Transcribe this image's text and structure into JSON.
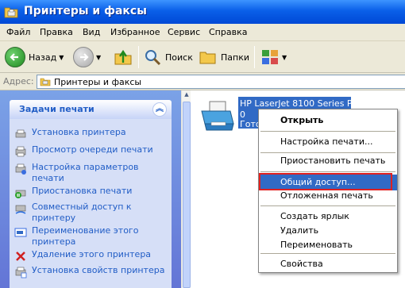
{
  "window": {
    "title": "Принтеры и факсы"
  },
  "menubar": [
    "Файл",
    "Правка",
    "Вид",
    "Избранное",
    "Сервис",
    "Справка"
  ],
  "toolbar": {
    "back_label": "Назад",
    "search_label": "Поиск",
    "folders_label": "Папки"
  },
  "address": {
    "label": "Адрес:",
    "value": "Принтеры и факсы"
  },
  "tasks_panel": {
    "title": "Задачи печати",
    "items": [
      "Установка принтера",
      "Просмотр очереди печати",
      "Настройка параметров печати",
      "Приостановка печати",
      "Совместный доступ к принтеру",
      "Переименование этого принтера",
      "Удаление этого принтера",
      "Установка свойств принтера"
    ]
  },
  "printer": {
    "name": "HP LaserJet 8100 Series PCL",
    "count": "0",
    "status": "Готов"
  },
  "context_menu": {
    "items": [
      "Открыть",
      "Настройка печати...",
      "Приостановить печать",
      "Общий доступ...",
      "Отложенная печать",
      "Создать ярлык",
      "Удалить",
      "Переименовать",
      "Свойства"
    ]
  },
  "colors": {
    "title_bar": "#0a5fe8",
    "selection": "#316ac5",
    "task_link": "#215dc6",
    "highlight_border": "#e02020"
  }
}
